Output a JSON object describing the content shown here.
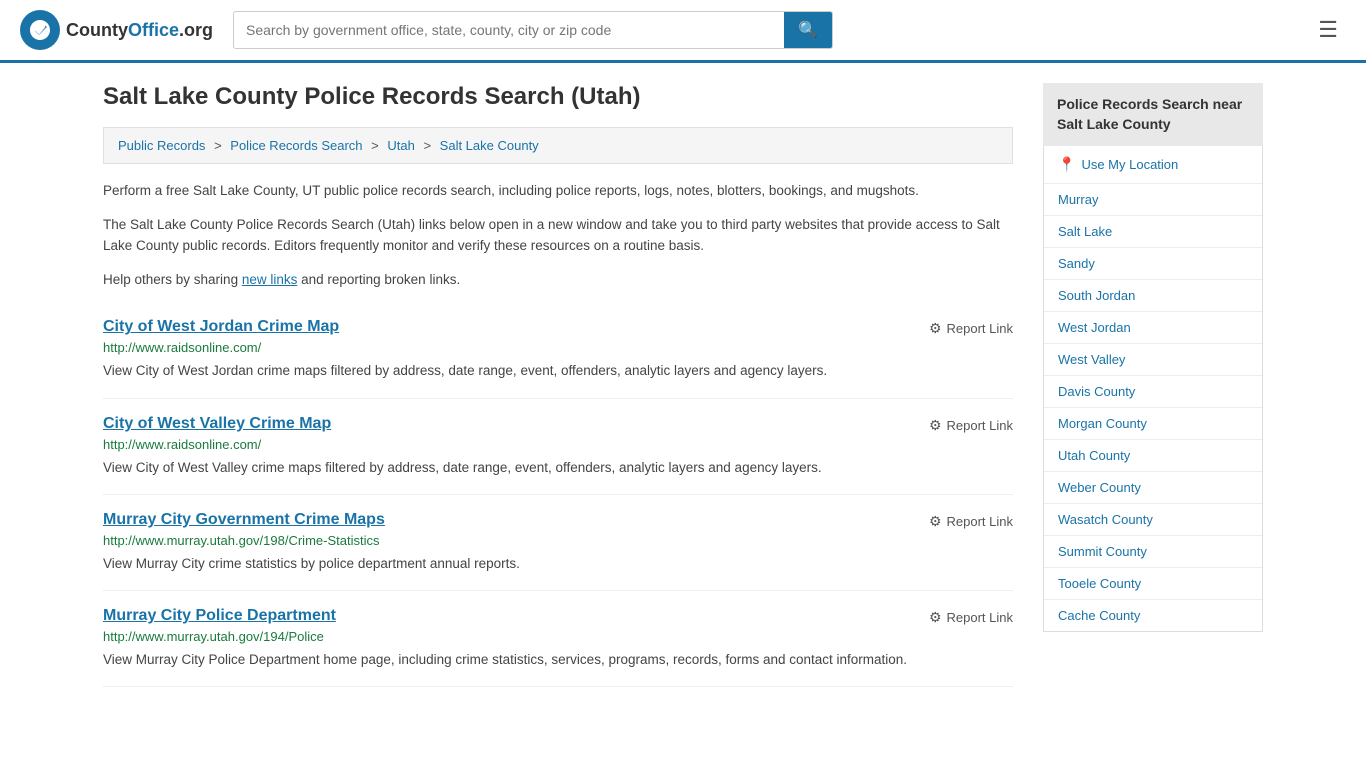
{
  "header": {
    "logo_text": "CountyOffice",
    "logo_org": ".org",
    "search_placeholder": "Search by government office, state, county, city or zip code",
    "search_button_label": "🔍"
  },
  "page": {
    "title": "Salt Lake County Police Records Search (Utah)",
    "breadcrumb": [
      {
        "label": "Public Records",
        "href": "#"
      },
      {
        "label": "Police Records Search",
        "href": "#"
      },
      {
        "label": "Utah",
        "href": "#"
      },
      {
        "label": "Salt Lake County",
        "href": "#"
      }
    ],
    "description1": "Perform a free Salt Lake County, UT public police records search, including police reports, logs, notes, blotters, bookings, and mugshots.",
    "description2": "The Salt Lake County Police Records Search (Utah) links below open in a new window and take you to third party websites that provide access to Salt Lake County public records. Editors frequently monitor and verify these resources on a routine basis.",
    "description3_prefix": "Help others by sharing ",
    "description3_link": "new links",
    "description3_suffix": " and reporting broken links."
  },
  "results": [
    {
      "title": "City of West Jordan Crime Map",
      "url": "http://www.raidsonline.com/",
      "description": "View City of West Jordan crime maps filtered by address, date range, event, offenders, analytic layers and agency layers.",
      "report_label": "Report Link"
    },
    {
      "title": "City of West Valley Crime Map",
      "url": "http://www.raidsonline.com/",
      "description": "View City of West Valley crime maps filtered by address, date range, event, offenders, analytic layers and agency layers.",
      "report_label": "Report Link"
    },
    {
      "title": "Murray City Government Crime Maps",
      "url": "http://www.murray.utah.gov/198/Crime-Statistics",
      "description": "View Murray City crime statistics by police department annual reports.",
      "report_label": "Report Link"
    },
    {
      "title": "Murray City Police Department",
      "url": "http://www.murray.utah.gov/194/Police",
      "description": "View Murray City Police Department home page, including crime statistics, services, programs, records, forms and contact information.",
      "report_label": "Report Link"
    }
  ],
  "sidebar": {
    "title": "Police Records Search near Salt Lake County",
    "use_location_label": "Use My Location",
    "links": [
      "Murray",
      "Salt Lake",
      "Sandy",
      "South Jordan",
      "West Jordan",
      "West Valley",
      "Davis County",
      "Morgan County",
      "Utah County",
      "Weber County",
      "Wasatch County",
      "Summit County",
      "Tooele County",
      "Cache County"
    ]
  }
}
